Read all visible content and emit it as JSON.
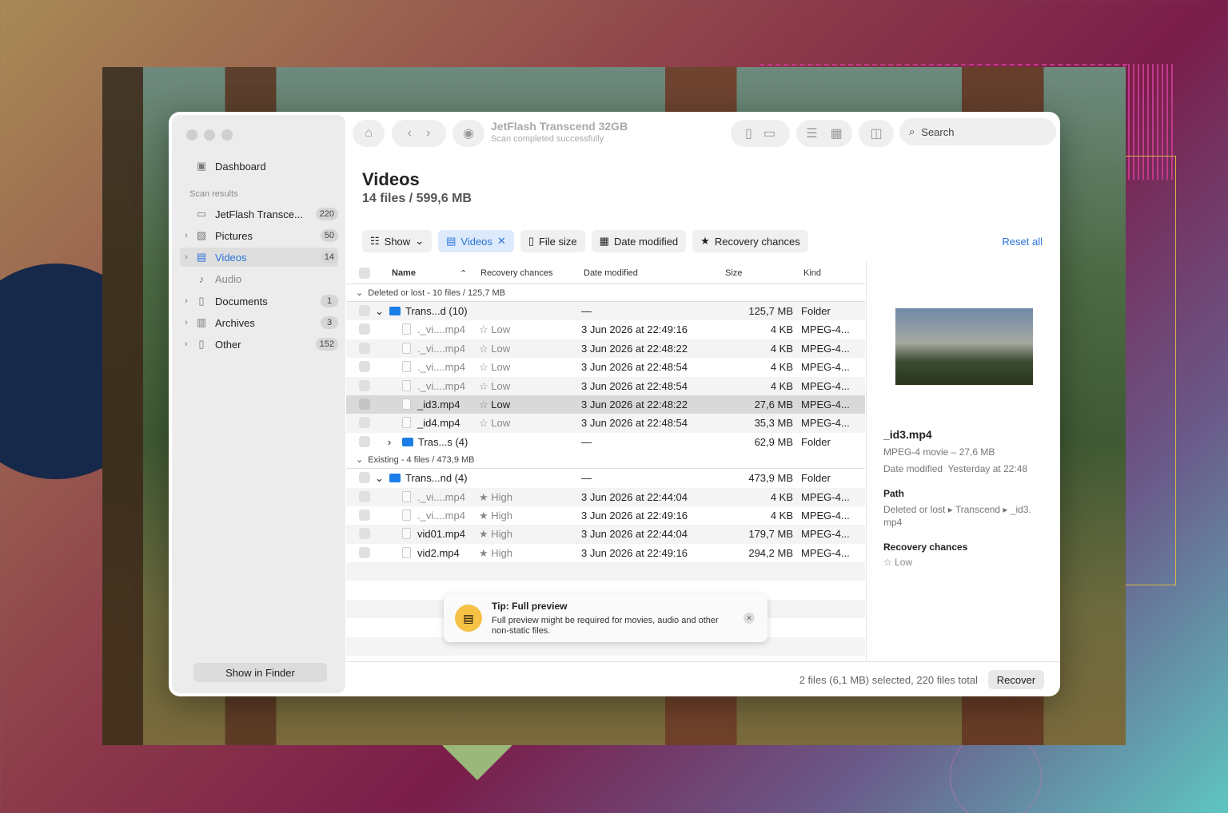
{
  "app": {
    "device_title": "JetFlash Transcend 32GB",
    "device_status": "Scan completed successfully",
    "search_placeholder": "Search"
  },
  "sidebar": {
    "dashboard": "Dashboard",
    "section_label": "Scan results",
    "items": [
      {
        "label": "JetFlash Transce...",
        "count": "220",
        "icon": "drive-icon"
      },
      {
        "label": "Pictures",
        "count": "50",
        "icon": "picture-icon"
      },
      {
        "label": "Videos",
        "count": "14",
        "icon": "film-icon"
      },
      {
        "label": "Audio",
        "count": "",
        "icon": "music-icon"
      },
      {
        "label": "Documents",
        "count": "1",
        "icon": "document-icon"
      },
      {
        "label": "Archives",
        "count": "3",
        "icon": "archive-icon"
      },
      {
        "label": "Other",
        "count": "152",
        "icon": "other-file-icon"
      }
    ],
    "show_in_finder": "Show in Finder"
  },
  "page": {
    "title": "Videos",
    "subtitle": "14 files / 599,6 MB"
  },
  "filters": {
    "show": "Show",
    "videos": "Videos",
    "file_size": "File size",
    "date_modified": "Date modified",
    "recovery_chances": "Recovery chances",
    "reset_all": "Reset all"
  },
  "table": {
    "columns": [
      "Name",
      "Recovery chances",
      "Date modified",
      "Size",
      "Kind"
    ],
    "groups": [
      {
        "label": "Deleted or lost - 10 files / 125,7 MB"
      },
      {
        "label": "Existing - 4 files / 473,9 MB"
      }
    ],
    "rows_deleted": [
      {
        "name": "Trans...d (10)",
        "chance": "",
        "date": "—",
        "size": "125,7 MB",
        "kind": "Folder"
      },
      {
        "name": "._vi....mp4",
        "chance": "Low",
        "date": "3 Jun 2026 at 22:49:16",
        "size": "4 KB",
        "kind": "MPEG-4..."
      },
      {
        "name": "._vi....mp4",
        "chance": "Low",
        "date": "3 Jun 2026 at 22:48:22",
        "size": "4 KB",
        "kind": "MPEG-4..."
      },
      {
        "name": "._vi....mp4",
        "chance": "Low",
        "date": "3 Jun 2026 at 22:48:54",
        "size": "4 KB",
        "kind": "MPEG-4..."
      },
      {
        "name": "._vi....mp4",
        "chance": "Low",
        "date": "3 Jun 2026 at 22:48:54",
        "size": "4 KB",
        "kind": "MPEG-4..."
      },
      {
        "name": "_id3.mp4",
        "chance": "Low",
        "date": "3 Jun 2026 at 22:48:22",
        "size": "27,6 MB",
        "kind": "MPEG-4..."
      },
      {
        "name": "_id4.mp4",
        "chance": "Low",
        "date": "3 Jun 2026 at 22:48:54",
        "size": "35,3 MB",
        "kind": "MPEG-4..."
      },
      {
        "name": "Tras...s (4)",
        "chance": "",
        "date": "—",
        "size": "62,9 MB",
        "kind": "Folder"
      }
    ],
    "rows_existing": [
      {
        "name": "Trans...nd (4)",
        "chance": "",
        "date": "—",
        "size": "473,9 MB",
        "kind": "Folder"
      },
      {
        "name": "._vi....mp4",
        "chance": "High",
        "date": "3 Jun 2026 at 22:44:04",
        "size": "4 KB",
        "kind": "MPEG-4..."
      },
      {
        "name": "._vi....mp4",
        "chance": "High",
        "date": "3 Jun 2026 at 22:49:16",
        "size": "4 KB",
        "kind": "MPEG-4..."
      },
      {
        "name": "vid01.mp4",
        "chance": "High",
        "date": "3 Jun 2026 at 22:44:04",
        "size": "179,7 MB",
        "kind": "MPEG-4..."
      },
      {
        "name": "vid2.mp4",
        "chance": "High",
        "date": "3 Jun 2026 at 22:49:16",
        "size": "294,2 MB",
        "kind": "MPEG-4..."
      }
    ]
  },
  "preview": {
    "filename": "_id3.mp4",
    "type_size": "MPEG-4 movie – 27,6 MB",
    "date_label": "Date modified",
    "date_value": "Yesterday at 22:48",
    "path_label": "Path",
    "path_value_1": "Deleted or lost ▸ Transcend ▸ _id3.",
    "path_value_2": "mp4",
    "chances_label": "Recovery chances",
    "chances_value": "Low"
  },
  "tip": {
    "title": "Tip: Full preview",
    "line1": "Full preview might be required for movies, audio and other",
    "line2": "non-static files."
  },
  "footer": {
    "status": "2 files (6,1 MB) selected, 220 files total",
    "recover": "Recover"
  },
  "colors": {
    "accent": "#2a72d8",
    "folder": "#1a7ee6",
    "tip_icon": "#f6c246"
  }
}
